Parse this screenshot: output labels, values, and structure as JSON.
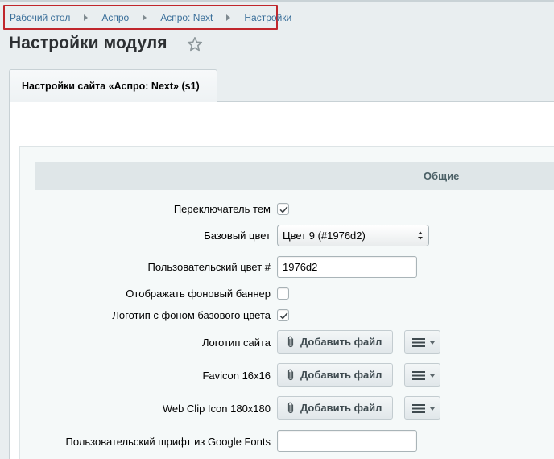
{
  "breadcrumb": {
    "items": [
      "Рабочий стол",
      "Аспро",
      "Аспро: Next",
      "Настройки"
    ]
  },
  "page": {
    "title": "Настройки модуля"
  },
  "tab": {
    "label": "Настройки сайта «Аспро: Next» (s1)"
  },
  "section": {
    "title": "Общие"
  },
  "form": {
    "theme_switcher": {
      "label": "Переключатель тем",
      "checked": true
    },
    "base_color": {
      "label": "Базовый цвет",
      "value": "Цвет 9 (#1976d2)"
    },
    "custom_color": {
      "label": "Пользовательский цвет #",
      "value": "1976d2"
    },
    "bg_banner": {
      "label": "Отображать фоновый баннер",
      "checked": false
    },
    "logo_bg": {
      "label": "Логотип с фоном базового цвета",
      "checked": true
    },
    "site_logo": {
      "label": "Логотип сайта",
      "button": "Добавить файл"
    },
    "favicon": {
      "label": "Favicon 16x16",
      "button": "Добавить файл"
    },
    "webclip": {
      "label": "Web Clip Icon 180x180",
      "button": "Добавить файл"
    },
    "google_font": {
      "label": "Пользовательский шрифт из Google Fonts",
      "value": ""
    }
  },
  "colors": {
    "accent_link": "#3a6f9a",
    "highlight_border": "#c0262c"
  },
  "icons": {
    "star": "star-icon",
    "clip": "paperclip-icon",
    "menu": "hamburger-icon"
  }
}
